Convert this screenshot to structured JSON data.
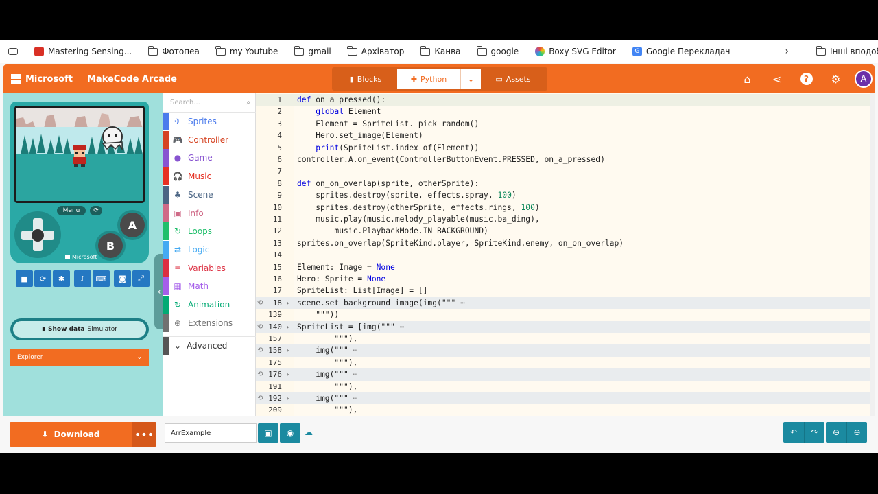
{
  "bookmarks": [
    {
      "label": "Mastering Sensing...",
      "icon": "bookmark-red-icon"
    },
    {
      "label": "Фотопеа",
      "icon": "folder-icon"
    },
    {
      "label": "my Youtube",
      "icon": "folder-icon"
    },
    {
      "label": "gmail",
      "icon": "folder-icon"
    },
    {
      "label": "Архіватор",
      "icon": "folder-icon"
    },
    {
      "label": "Канва",
      "icon": "folder-icon"
    },
    {
      "label": "google",
      "icon": "folder-icon"
    },
    {
      "label": "Boxy SVG Editor",
      "icon": "boxy-icon"
    },
    {
      "label": "Google Перекладач",
      "icon": "translate-icon"
    }
  ],
  "other_bookmarks": "Інші вподобання",
  "header": {
    "brand": "Microsoft",
    "title": "MakeCode Arcade",
    "modes": {
      "blocks": "Blocks",
      "python": "Python",
      "assets": "Assets"
    },
    "avatar": "A"
  },
  "simulator": {
    "menu": "Menu",
    "btn_a": "A",
    "btn_b": "B",
    "console_brand": "Microsoft",
    "show_data_bold": "Show data",
    "show_data_rest": "Simulator",
    "explorer": "Explorer"
  },
  "toolbox": {
    "search_placeholder": "Search...",
    "categories": [
      {
        "label": "Sprites",
        "color": "#4b7bec",
        "icon": "plane-icon",
        "glyph": "✈"
      },
      {
        "label": "Controller",
        "color": "#d54322",
        "icon": "gamepad-icon",
        "glyph": "🎮"
      },
      {
        "label": "Game",
        "color": "#8854d0",
        "icon": "circle-icon",
        "glyph": "●"
      },
      {
        "label": "Music",
        "color": "#e63022",
        "icon": "headphones-icon",
        "glyph": "🎧"
      },
      {
        "label": "Scene",
        "color": "#4b6584",
        "icon": "tree-icon",
        "glyph": "♣"
      },
      {
        "label": "Info",
        "color": "#cf6a87",
        "icon": "id-card-icon",
        "glyph": "▣"
      },
      {
        "label": "Loops",
        "color": "#20bf6b",
        "icon": "loop-icon",
        "glyph": "↻"
      },
      {
        "label": "Logic",
        "color": "#45aaf2",
        "icon": "shuffle-icon",
        "glyph": "⇄"
      },
      {
        "label": "Variables",
        "color": "#dc2f41",
        "icon": "list-icon",
        "glyph": "≡"
      },
      {
        "label": "Math",
        "color": "#a55eea",
        "icon": "calculator-icon",
        "glyph": "▦"
      },
      {
        "label": "Animation",
        "color": "#03aa74",
        "icon": "refresh-icon",
        "glyph": "↻"
      },
      {
        "label": "Extensions",
        "color": "#717171",
        "icon": "plus-circle-icon",
        "glyph": "⊕"
      }
    ],
    "advanced": "Advanced"
  },
  "editor": {
    "lines": [
      {
        "num": "1",
        "code": "def on_a_pressed():",
        "cur": true
      },
      {
        "num": "2",
        "code": "    global Element"
      },
      {
        "num": "3",
        "code": "    Element = SpriteList._pick_random()"
      },
      {
        "num": "4",
        "code": "    Hero.set_image(Element)"
      },
      {
        "num": "5",
        "code": "    print(SpriteList.index_of(Element))"
      },
      {
        "num": "6",
        "code": "controller.A.on_event(ControllerButtonEvent.PRESSED, on_a_pressed)"
      },
      {
        "num": "7",
        "code": ""
      },
      {
        "num": "8",
        "code": "def on_on_overlap(sprite, otherSprite):"
      },
      {
        "num": "9",
        "code": "    sprites.destroy(sprite, effects.spray, 100)"
      },
      {
        "num": "10",
        "code": "    sprites.destroy(otherSprite, effects.rings, 100)"
      },
      {
        "num": "11",
        "code": "    music.play(music.melody_playable(music.ba_ding),"
      },
      {
        "num": "12",
        "code": "        music.PlaybackMode.IN_BACKGROUND)"
      },
      {
        "num": "13",
        "code": "sprites.on_overlap(SpriteKind.player, SpriteKind.enemy, on_on_overlap)"
      },
      {
        "num": "14",
        "code": ""
      },
      {
        "num": "15",
        "code": "Element: Image = None"
      },
      {
        "num": "16",
        "code": "Hero: Sprite = None"
      },
      {
        "num": "17",
        "code": "SpriteList: List[Image] = []"
      },
      {
        "num": "18",
        "code": "scene.set_background_image(img(\"\"\"",
        "fold": true,
        "dots": "⋯"
      },
      {
        "num": "139",
        "code": "    \"\"\"))"
      },
      {
        "num": "140",
        "code": "SpriteList = [img(\"\"\"",
        "fold": true,
        "dots": "⋯"
      },
      {
        "num": "157",
        "code": "        \"\"\"),"
      },
      {
        "num": "158",
        "code": "    img(\"\"\"",
        "fold": true,
        "dots": "⋯"
      },
      {
        "num": "175",
        "code": "        \"\"\"),"
      },
      {
        "num": "176",
        "code": "    img(\"\"\"",
        "fold": true,
        "dots": "⋯"
      },
      {
        "num": "191",
        "code": "        \"\"\"),"
      },
      {
        "num": "192",
        "code": "    img(\"\"\"",
        "fold": true,
        "dots": "⋯"
      },
      {
        "num": "209",
        "code": "        \"\"\"),"
      }
    ]
  },
  "footer": {
    "download": "Download",
    "more": "•••",
    "project_name": "ArrExample"
  }
}
